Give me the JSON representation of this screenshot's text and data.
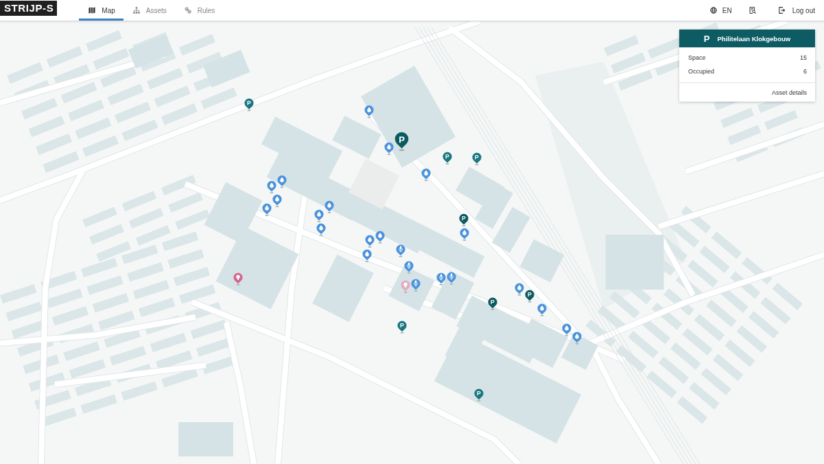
{
  "header": {
    "logo": "STRIJP-S",
    "tabs": [
      {
        "label": "Map",
        "selected": true
      },
      {
        "label": "Assets",
        "selected": false
      },
      {
        "label": "Rules",
        "selected": false
      }
    ],
    "language": "EN",
    "logout": "Log out"
  },
  "map": {
    "markers": [
      {
        "kind": "parking",
        "label": "P",
        "color": "#1b7880",
        "selected": false
      },
      {
        "kind": "water",
        "color": "#4b93dc",
        "selected": false
      },
      {
        "kind": "water",
        "color": "#4b93dc",
        "selected": false
      },
      {
        "kind": "parking",
        "label": "P",
        "color": "#0d5b62",
        "selected": true
      },
      {
        "kind": "parking",
        "label": "P",
        "color": "#1b7880",
        "selected": false
      },
      {
        "kind": "parking",
        "label": "P",
        "color": "#1b7880",
        "selected": false
      },
      {
        "kind": "water",
        "color": "#4b93dc",
        "selected": false
      },
      {
        "kind": "water",
        "color": "#4b93dc",
        "selected": false
      },
      {
        "kind": "water",
        "color": "#4b93dc",
        "selected": false
      },
      {
        "kind": "water",
        "color": "#4b93dc",
        "selected": false
      },
      {
        "kind": "water",
        "color": "#4b93dc",
        "selected": false
      },
      {
        "kind": "water",
        "color": "#4b93dc",
        "selected": false
      },
      {
        "kind": "water",
        "color": "#4b93dc",
        "selected": false
      },
      {
        "kind": "water",
        "color": "#4b93dc",
        "selected": false
      },
      {
        "kind": "water",
        "color": "#4b93dc",
        "selected": false
      },
      {
        "kind": "parking",
        "label": "P",
        "color": "#0d5b62",
        "selected": false
      },
      {
        "kind": "water",
        "color": "#4b93dc",
        "selected": false
      },
      {
        "kind": "water",
        "color": "#4b93dc",
        "selected": false
      },
      {
        "kind": "water",
        "color": "#4b93dc",
        "selected": false
      },
      {
        "kind": "microphone",
        "color": "#4b93dc",
        "selected": false
      },
      {
        "kind": "microphone",
        "color": "#4b93dc",
        "selected": false
      },
      {
        "kind": "microphone",
        "color": "#4b93dc",
        "selected": false
      },
      {
        "kind": "microphone",
        "color": "#4b93dc",
        "selected": false
      },
      {
        "kind": "light",
        "color": "#d4668c",
        "selected": false
      },
      {
        "kind": "light",
        "color": "#e5abbf",
        "selected": false
      },
      {
        "kind": "microphone",
        "color": "#4b93dc",
        "selected": false
      },
      {
        "kind": "water",
        "color": "#4b93dc",
        "selected": false
      },
      {
        "kind": "parking",
        "label": "P",
        "color": "#0d5b62",
        "selected": false
      },
      {
        "kind": "parking",
        "label": "P",
        "color": "#0d5b62",
        "selected": false
      },
      {
        "kind": "water",
        "color": "#4b93dc",
        "selected": false
      },
      {
        "kind": "water",
        "color": "#4b93dc",
        "selected": false
      },
      {
        "kind": "water",
        "color": "#4b93dc",
        "selected": false
      },
      {
        "kind": "parking",
        "label": "P",
        "color": "#1b7880",
        "selected": false
      },
      {
        "kind": "parking",
        "label": "P",
        "color": "#1b7880",
        "selected": false
      }
    ]
  },
  "popup": {
    "badge": "P",
    "title": "Philitelaan Klokgebouw",
    "rows": [
      {
        "label": "Space",
        "value": "15"
      },
      {
        "label": "Occupied",
        "value": "6"
      }
    ],
    "link": "Asset details"
  }
}
